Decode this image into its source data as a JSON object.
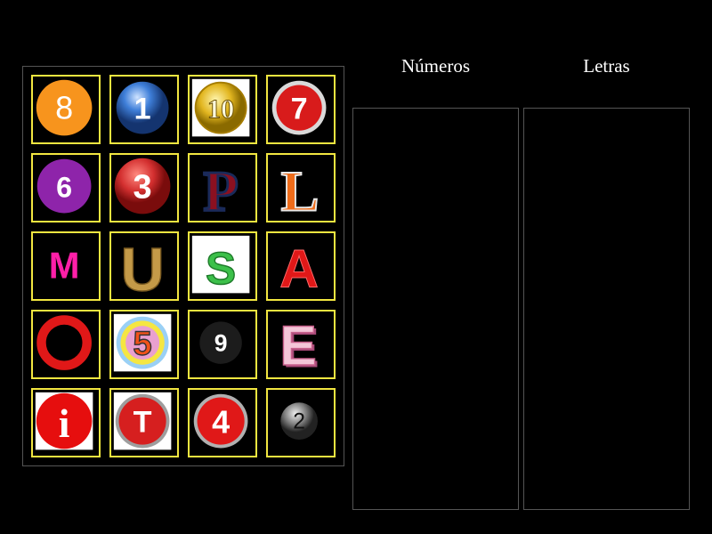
{
  "columns": {
    "numbers": "Números",
    "letters": "Letras"
  },
  "tiles": [
    {
      "label": "8",
      "icon": "orange-circle-8-icon"
    },
    {
      "label": "1",
      "icon": "blue-orb-1-icon"
    },
    {
      "label": "10",
      "icon": "gold-coin-10-icon"
    },
    {
      "label": "7",
      "icon": "red-ball-7-icon"
    },
    {
      "label": "6",
      "icon": "purple-circle-6-icon"
    },
    {
      "label": "3",
      "icon": "red-ball-3-icon"
    },
    {
      "label": "P",
      "icon": "red-letter-p-icon"
    },
    {
      "label": "L",
      "icon": "orange-letter-l-icon"
    },
    {
      "label": "M",
      "icon": "pink-letter-m-icon"
    },
    {
      "label": "U",
      "icon": "gold-letter-u-icon"
    },
    {
      "label": "S",
      "icon": "green-letter-s-icon"
    },
    {
      "label": "A",
      "icon": "red-letter-a-icon"
    },
    {
      "label": "O",
      "icon": "red-letter-o-icon"
    },
    {
      "label": "5",
      "icon": "rainbow-circle-5-icon"
    },
    {
      "label": "9",
      "icon": "black-ball-9-icon"
    },
    {
      "label": "E",
      "icon": "pink-block-letter-e-icon"
    },
    {
      "label": "i",
      "icon": "red-info-i-icon"
    },
    {
      "label": "T",
      "icon": "red-button-t-icon"
    },
    {
      "label": "4",
      "icon": "red-ball-4-icon"
    },
    {
      "label": "2",
      "icon": "silver-ball-2-icon"
    }
  ]
}
